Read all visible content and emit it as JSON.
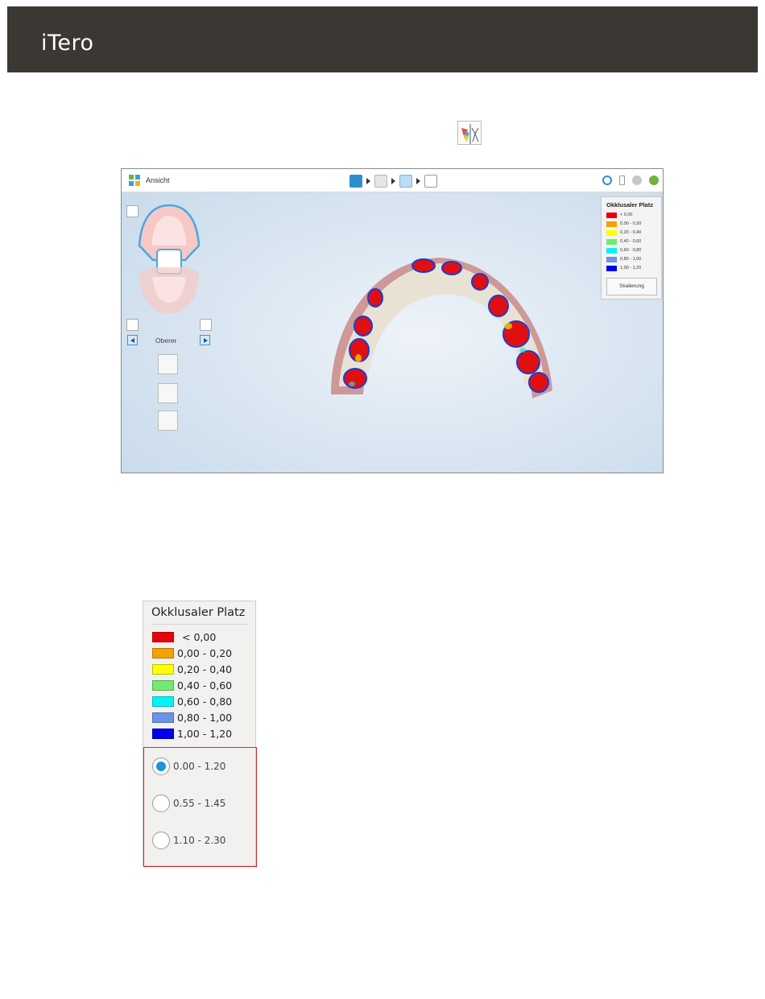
{
  "header": {
    "logo": "iTero"
  },
  "screenshot": {
    "topbar": {
      "view_label": "Ansicht"
    },
    "legend": {
      "title": "Okklusaler Platz",
      "rows": [
        {
          "label": "< 0,00",
          "color": "#e8000b"
        },
        {
          "label": "0,00 - 0,20",
          "color": "#f5a000"
        },
        {
          "label": "0,20 - 0,40",
          "color": "#ffff00"
        },
        {
          "label": "0,40 - 0,60",
          "color": "#72ea72"
        },
        {
          "label": "0,60 - 0,80",
          "color": "#00f5f5"
        },
        {
          "label": "0,80 - 1,00",
          "color": "#6a94e6"
        },
        {
          "label": "1,00 - 1,20",
          "color": "#0000ee"
        }
      ],
      "scale_button": "Skalierung"
    },
    "jaw_label": "Oberer"
  },
  "zoom_legend": {
    "title": "Okklusaler Platz",
    "rows": [
      {
        "label": "< 0,00",
        "color": "#e8000b"
      },
      {
        "label": "0,00 - 0,20",
        "color": "#f5a000"
      },
      {
        "label": "0,20 - 0,40",
        "color": "#ffff00"
      },
      {
        "label": "0,40 - 0,60",
        "color": "#72ea72"
      },
      {
        "label": "0,60 - 0,80",
        "color": "#00f5f5"
      },
      {
        "label": "0,80 - 1,00",
        "color": "#6a94e6"
      },
      {
        "label": "1,00 - 1,20",
        "color": "#0000ee"
      }
    ],
    "scale_options": [
      {
        "label": "0.00 - 1.20",
        "selected": true
      },
      {
        "label": "0.55 - 1.45",
        "selected": false
      },
      {
        "label": "1.10 - 2.30",
        "selected": false
      }
    ]
  }
}
